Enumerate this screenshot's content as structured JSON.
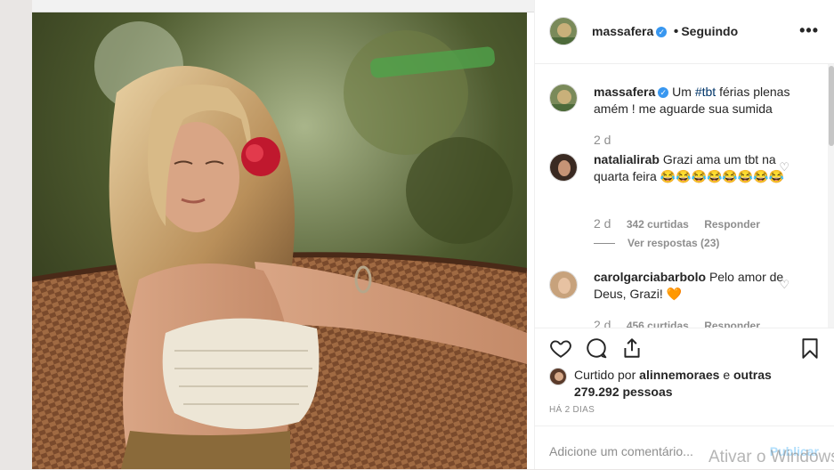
{
  "post": {
    "username": "massafera",
    "following_label": "Seguindo",
    "more_label": "•••",
    "caption_text": "Um",
    "caption_hashtag": "#tbt",
    "caption_rest": "férias plenas amém ! me aguarde sua sumida",
    "caption_time": "2 d"
  },
  "comments": [
    {
      "username": "natalialirab",
      "text": "Grazi ama um tbt na quarta feira 😂😂😂😂😂😂😂😂",
      "time": "2 d",
      "likes": "342 curtidas",
      "reply_label": "Responder",
      "view_replies": "Ver respostas (23)"
    },
    {
      "username": "carolgarciabarbolo",
      "text": "Pelo amor de Deus, Grazi! 🧡",
      "time": "2 d",
      "likes": "456 curtidas",
      "reply_label": "Responder"
    }
  ],
  "likes": {
    "prefix": "Curtido por",
    "user": "alinnemoraes",
    "conj": "e",
    "others": "outras 279.292 pessoas"
  },
  "time_ago": "HÁ 2 DIAS",
  "add_comment": {
    "placeholder": "Adicione um comentário...",
    "publish_label": "Publicar"
  },
  "watermark": "Ativar o Windows",
  "colors": {
    "verified": "#3897f0",
    "publish": "#b2dffc",
    "muted": "#8e8e8e"
  },
  "icons": [
    "heart-icon",
    "comment-icon",
    "share-icon",
    "bookmark-icon",
    "verified-icon",
    "more-icon"
  ]
}
